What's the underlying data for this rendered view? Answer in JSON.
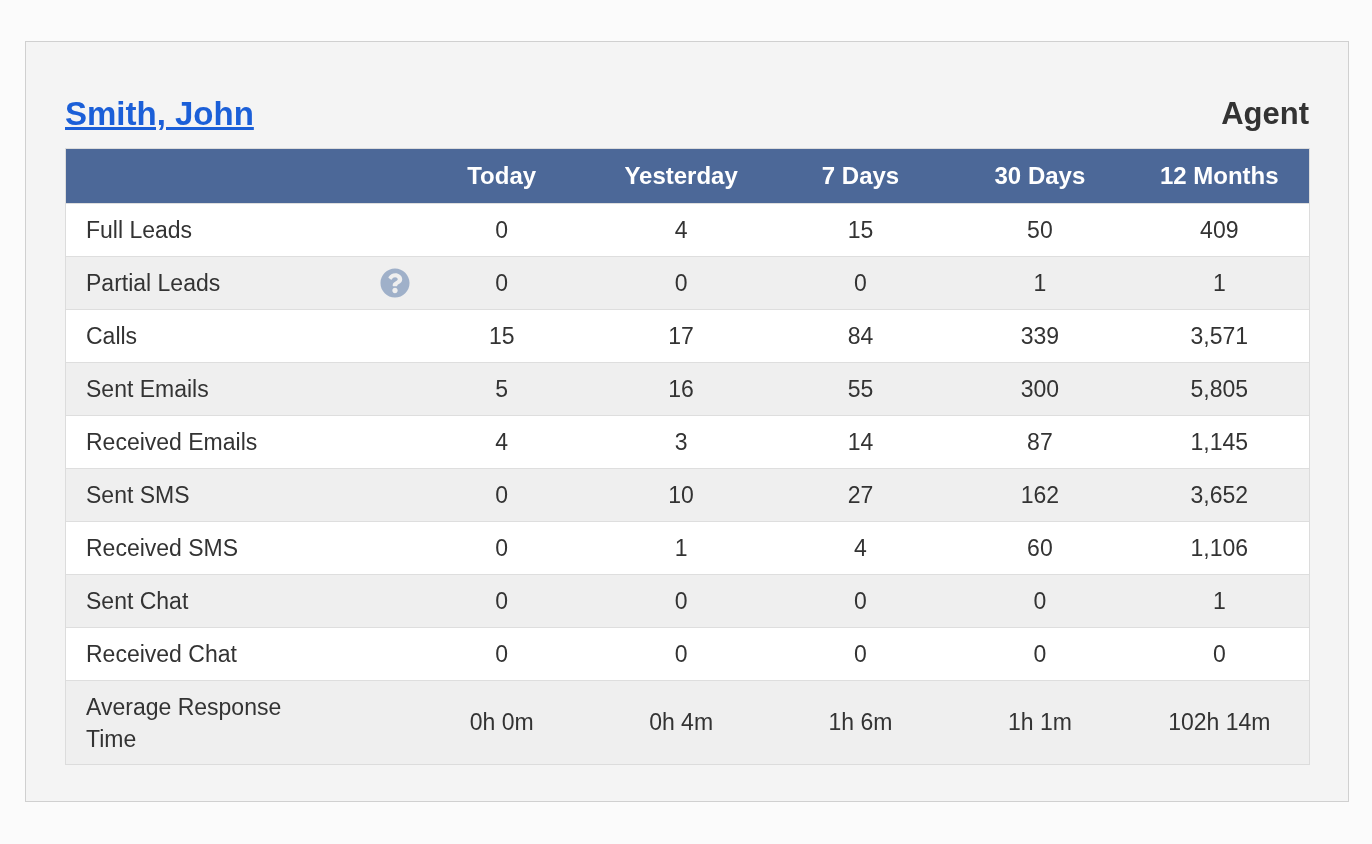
{
  "agent": {
    "name": "Smith, John",
    "role": "Agent"
  },
  "table": {
    "columns": [
      "Today",
      "Yesterday",
      "7 Days",
      "30 Days",
      "12 Months"
    ],
    "rows": [
      {
        "label": "Full Leads",
        "help": false,
        "values": [
          "0",
          "4",
          "15",
          "50",
          "409"
        ]
      },
      {
        "label": "Partial Leads",
        "help": true,
        "values": [
          "0",
          "0",
          "0",
          "1",
          "1"
        ]
      },
      {
        "label": "Calls",
        "help": false,
        "values": [
          "15",
          "17",
          "84",
          "339",
          "3,571"
        ]
      },
      {
        "label": "Sent Emails",
        "help": false,
        "values": [
          "5",
          "16",
          "55",
          "300",
          "5,805"
        ]
      },
      {
        "label": "Received Emails",
        "help": false,
        "values": [
          "4",
          "3",
          "14",
          "87",
          "1,145"
        ]
      },
      {
        "label": "Sent SMS",
        "help": false,
        "values": [
          "0",
          "10",
          "27",
          "162",
          "3,652"
        ]
      },
      {
        "label": "Received SMS",
        "help": false,
        "values": [
          "0",
          "1",
          "4",
          "60",
          "1,106"
        ]
      },
      {
        "label": "Sent Chat",
        "help": false,
        "values": [
          "0",
          "0",
          "0",
          "0",
          "1"
        ]
      },
      {
        "label": "Received Chat",
        "help": false,
        "values": [
          "0",
          "0",
          "0",
          "0",
          "0"
        ]
      },
      {
        "label": "Average Response Time",
        "help": false,
        "values": [
          "0h 0m",
          "0h 4m",
          "1h 6m",
          "1h 1m",
          "102h 14m"
        ]
      }
    ]
  }
}
